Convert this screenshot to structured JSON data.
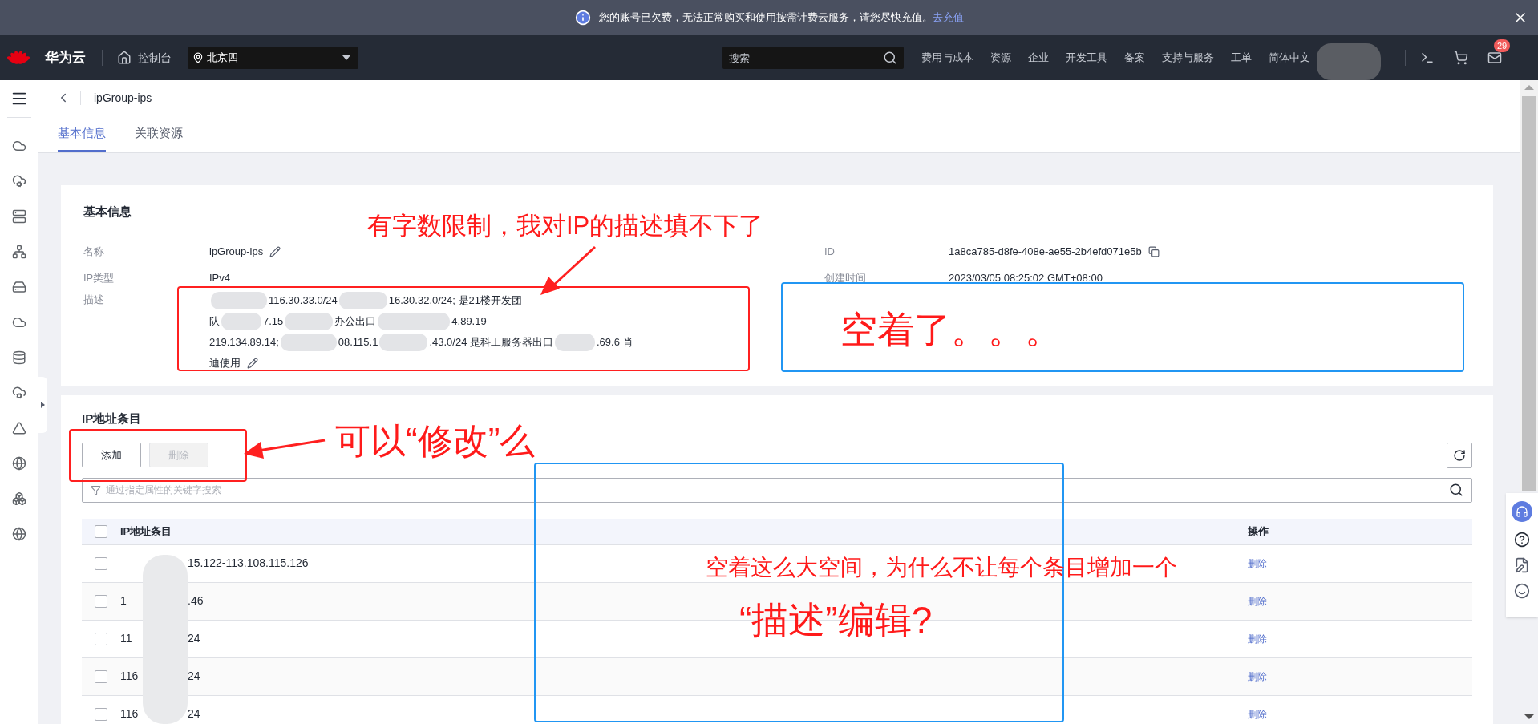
{
  "banner": {
    "message": "您的账号已欠费，无法正常购买和使用按需计费云服务，请您尽快充值。",
    "link": "去充值"
  },
  "nav": {
    "brand": "华为云",
    "console": "控制台",
    "region": "北京四",
    "search_placeholder": "搜索",
    "links": [
      "费用与成本",
      "资源",
      "企业",
      "开发工具",
      "备案",
      "支持与服务",
      "工单",
      "简体中文"
    ],
    "mail_badge": "29"
  },
  "page": {
    "title": "ipGroup-ips"
  },
  "tabs": [
    {
      "label": "基本信息",
      "selected": true
    },
    {
      "label": "关联资源",
      "selected": false
    }
  ],
  "basic_info": {
    "title": "基本信息",
    "name": {
      "label": "名称",
      "value": "ipGroup-ips"
    },
    "ip_type": {
      "label": "IP类型",
      "value": "IPv4"
    },
    "description": {
      "label": "描述",
      "lines": [
        [
          {
            "kind": "blur"
          },
          {
            "kind": "text",
            "text": "116.30.33.0/24"
          },
          {
            "kind": "blur"
          },
          {
            "kind": "text",
            "text": "16.30.32.0/24; 是21楼开发团"
          }
        ],
        [
          {
            "kind": "text",
            "text": "队"
          },
          {
            "kind": "blur"
          },
          {
            "kind": "text",
            "text": "7.15"
          },
          {
            "kind": "blur"
          },
          {
            "kind": "text",
            "text": "办公出口"
          },
          {
            "kind": "blur"
          },
          {
            "kind": "text",
            "text": "4.89.19"
          }
        ],
        [
          {
            "kind": "text",
            "text": "219.134.89.14;"
          },
          {
            "kind": "blur"
          },
          {
            "kind": "text",
            "text": "08.115.1"
          },
          {
            "kind": "blur"
          },
          {
            "kind": "text",
            "text": ".43.0/24 是科工服务器出口"
          },
          {
            "kind": "blur"
          },
          {
            "kind": "text",
            "text": ".69.6 肖"
          }
        ],
        [
          {
            "kind": "text",
            "text": "迪使用"
          }
        ]
      ]
    },
    "id": {
      "label": "ID",
      "value": "1a8ca785-d8fe-408e-ae55-2b4efd071e5b"
    },
    "created": {
      "label": "创建时间",
      "value": "2023/03/05 08:25:02 GMT+08:00"
    }
  },
  "ip_entries": {
    "title": "IP地址条目",
    "add_button": "添加",
    "delete_button": {
      "label": "删除",
      "disabled": true
    },
    "search_placeholder": "通过指定属性的关键字搜索",
    "columns": [
      "IP地址条目",
      "操作"
    ],
    "header_checked": false,
    "rows": [
      {
        "start": "",
        "end": "15.122-113.108.115.126",
        "action": "删除",
        "checked": false
      },
      {
        "start": "1",
        "end": ".46",
        "action": "删除",
        "checked": false
      },
      {
        "start": "11",
        "end": "24",
        "action": "删除",
        "checked": false
      },
      {
        "start": "116",
        "end": "24",
        "action": "删除",
        "checked": false
      },
      {
        "start": "116",
        "end": "24",
        "action": "删除",
        "checked": false
      }
    ]
  },
  "annotations": [
    {
      "text": "有字数限制，我对IP的描述填不下了"
    },
    {
      "text": "空着了。。。"
    },
    {
      "text": "可以“修改”么"
    },
    {
      "text": "空着这么大空间，为什么不让每个条目增加一个"
    },
    {
      "text": "“描述”编辑?"
    }
  ]
}
